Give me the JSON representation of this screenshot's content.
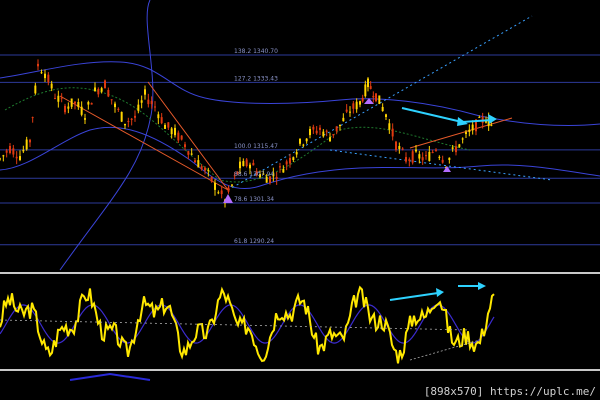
{
  "chart_data": [
    {
      "type": "candlestick",
      "title": "",
      "fib_levels": [
        {
          "label": "138.2 1340.70",
          "value": 1340.7
        },
        {
          "label": "127.2 1333.43",
          "value": 1333.43
        },
        {
          "label": "100.0 1315.47",
          "value": 1315.47
        },
        {
          "label": "88.6 1307.94",
          "value": 1307.94
        },
        {
          "label": "78.6 1301.34",
          "value": 1301.34
        },
        {
          "label": "61.8 1290.24",
          "value": 1290.24
        }
      ],
      "price_range": [
        1283,
        1350
      ],
      "colors": {
        "up_candle": "#ffd400",
        "down_candle": "#e03a10",
        "fib_line": "#2d3a9a",
        "trendline": "#e65a2a",
        "channel": "#3a44d8",
        "dotted_line": "#39a0ff",
        "annotation_arrow": "#2ed2ff",
        "pivot_marker": "#b36cff"
      }
    },
    {
      "type": "line",
      "title": "",
      "colors": {
        "oscillator": "#ffe800",
        "signal": "#3b2bcf",
        "panel_border": "#c8c8c8"
      }
    }
  ],
  "footer": {
    "watermark": "[898x570] https://uplc.me/"
  }
}
